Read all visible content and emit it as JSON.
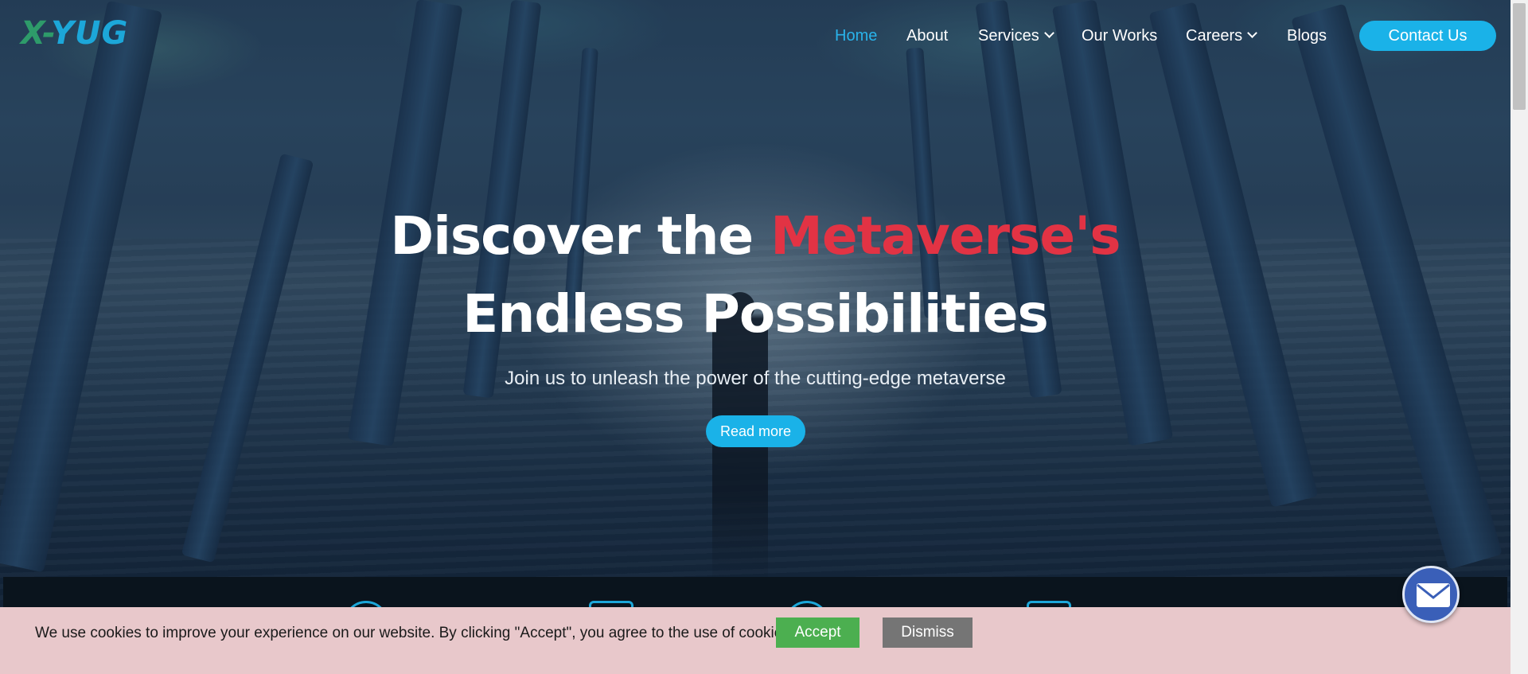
{
  "brand": {
    "logo_x": "X",
    "logo_dash": "-",
    "logo_yug": "YUG"
  },
  "nav": {
    "items": [
      {
        "label": "Home",
        "active": true
      },
      {
        "label": "About"
      },
      {
        "label": "Services",
        "dropdown": true
      },
      {
        "label": "Our Works"
      },
      {
        "label": "Careers",
        "dropdown": true
      },
      {
        "label": "Blogs"
      }
    ],
    "contact_label": "Contact Us"
  },
  "hero": {
    "line1_prefix": "Discover the ",
    "line1_accent": "Metaverse's",
    "line2": "Endless Possibilities",
    "subtitle": "Join us to unleash the power of the cutting-edge metaverse",
    "cta_label": "Read more"
  },
  "stats": {
    "items": [
      {
        "icon": "circle-icon"
      },
      {
        "icon": "square-icon"
      },
      {
        "icon": "circle-icon"
      },
      {
        "icon": "shield-icon"
      }
    ]
  },
  "cookie": {
    "message": "We use cookies to improve your experience on our website. By clicking \"Accept\", you agree to the use of cookies.",
    "accept_label": "Accept",
    "dismiss_label": "Dismiss"
  },
  "fab": {
    "icon": "mail-icon"
  },
  "colors": {
    "accent": "#1ab2e8",
    "headline_accent": "#e23344",
    "accept": "#4caf50",
    "dismiss": "#757575",
    "cookie_bg": "#e8c8cb"
  }
}
